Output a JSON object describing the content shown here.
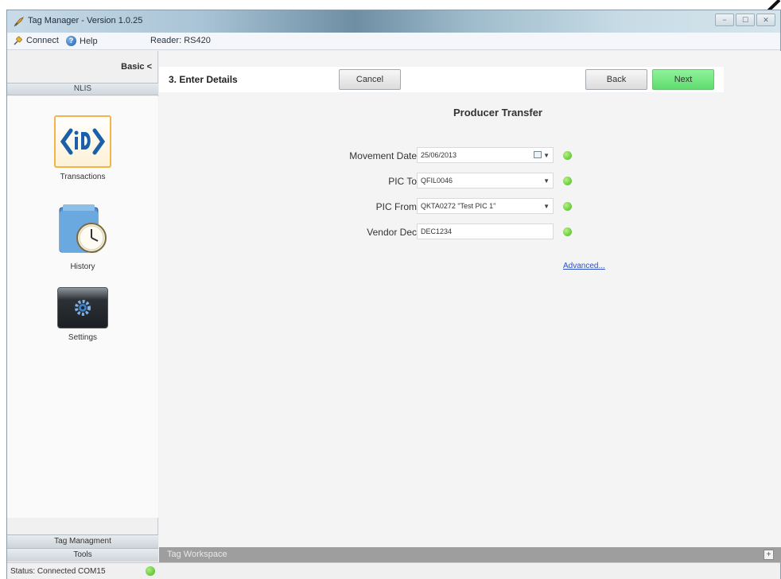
{
  "window": {
    "title": "Tag Manager - Version 1.0.25",
    "buttons": [
      "−",
      "☐",
      "✕"
    ]
  },
  "menubar": {
    "connect": "Connect",
    "help": "Help",
    "reader": "Reader: RS420"
  },
  "sidebar": {
    "mode_toggle": "Basic <",
    "section": "NLIS",
    "items": [
      {
        "label": "Transactions",
        "icon": "id-logo-icon"
      },
      {
        "label": "History",
        "icon": "history-clock-icon"
      },
      {
        "label": "Settings",
        "icon": "settings-gear-icon"
      }
    ],
    "bottom_buttons": [
      "Tag Managment",
      "Tools"
    ]
  },
  "step": {
    "title": "3. Enter Details",
    "cancel": "Cancel",
    "back": "Back",
    "next": "Next"
  },
  "form": {
    "title": "Producer Transfer",
    "fields": [
      {
        "label": "Movement Date",
        "value": "25/06/2013",
        "control": "date-picker"
      },
      {
        "label": "PIC To",
        "value": "QFIL0046",
        "control": "dropdown"
      },
      {
        "label": "PIC From",
        "value": "QKTA0272 \"Test PIC 1\"",
        "control": "dropdown"
      },
      {
        "label": "Vendor Dec",
        "value": "DEC1234",
        "control": "text"
      }
    ],
    "advanced_link": "Advanced..."
  },
  "workspace": {
    "label": "Tag Workspace",
    "expand": "+"
  },
  "status": {
    "text": "Status: Connected COM15"
  },
  "colors": {
    "next_button": "#6fe07c",
    "status_ok": "#4bb51d",
    "transactions_highlight": "#f3b44a",
    "link": "#2b4fc7"
  }
}
